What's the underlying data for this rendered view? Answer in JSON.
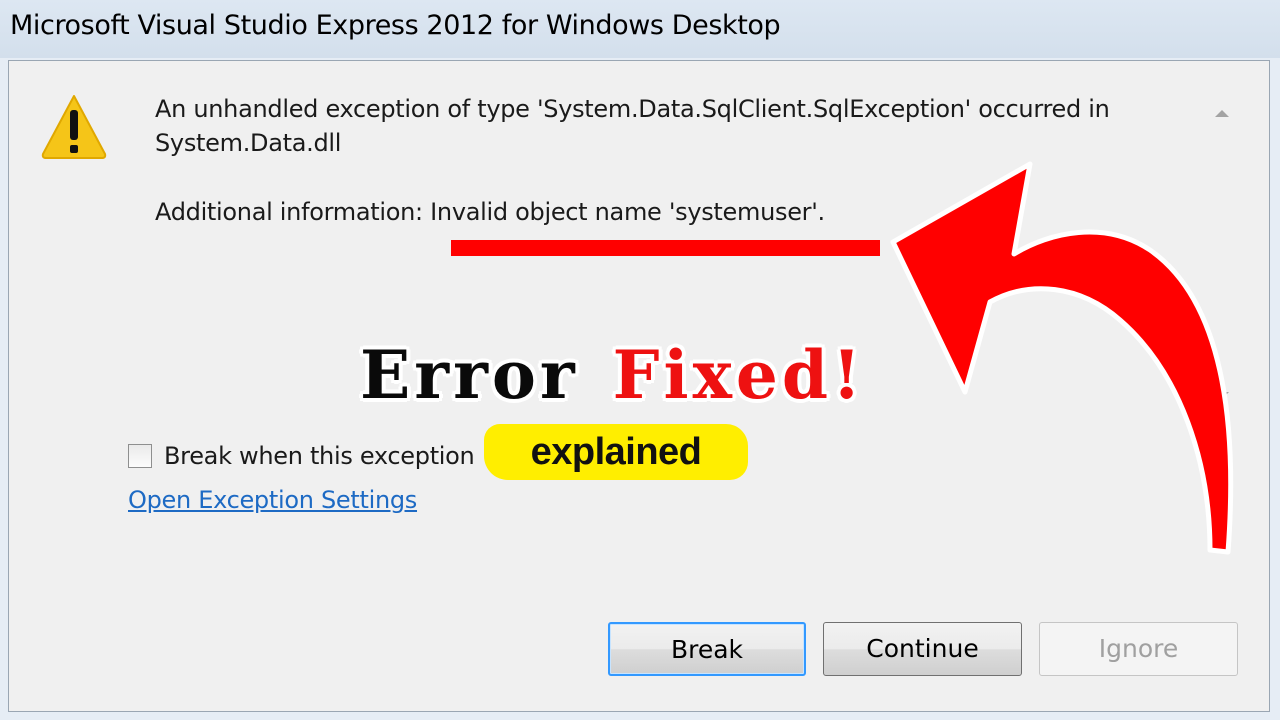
{
  "window": {
    "title": "Microsoft Visual Studio Express 2012 for Windows Desktop"
  },
  "dialog": {
    "message_line1": "An unhandled exception of type 'System.Data.SqlClient.SqlException' occurred in",
    "message_line2": "System.Data.dll",
    "additional_label": "Additional information: ",
    "additional_value": "Invalid object name 'systemuser'.",
    "checkbox_label": "Break when this exception",
    "checkbox_checked": false,
    "settings_link": "Open Exception Settings",
    "buttons": {
      "break": "Break",
      "continue": "Continue",
      "ignore": "Ignore"
    }
  },
  "overlay": {
    "headline_word1": "Error",
    "headline_word2": "Fixed!",
    "badge": "explained"
  },
  "colors": {
    "accent_red": "#ff0000",
    "headline_red": "#ee1111",
    "badge_yellow": "#ffee00",
    "link_blue": "#1d6ac4",
    "warning_yellow": "#f5c518"
  },
  "icons": [
    "warning-icon",
    "scroll-up-icon",
    "scroll-down-icon"
  ]
}
